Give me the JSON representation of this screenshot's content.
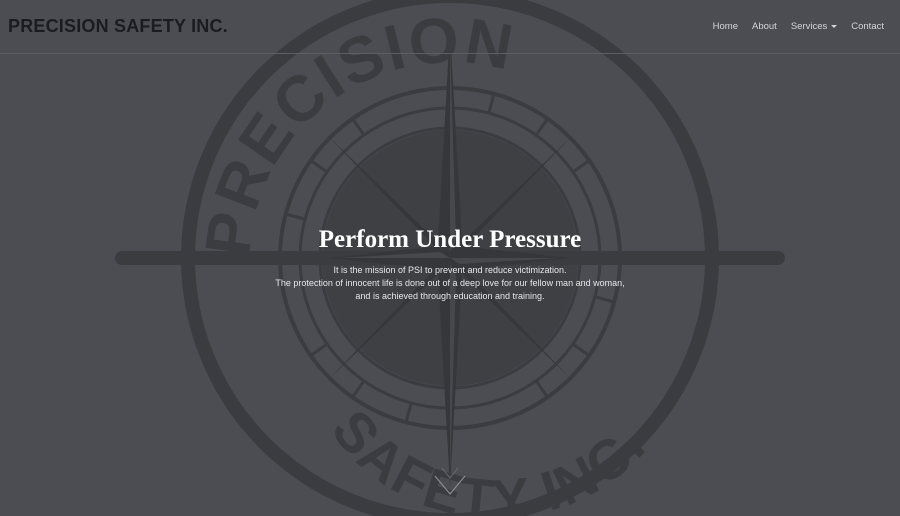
{
  "brand": {
    "name": "PRECISION SAFETY INC."
  },
  "nav": {
    "items": [
      {
        "label": "Home"
      },
      {
        "label": "About"
      },
      {
        "label": "Services",
        "dropdown": true
      },
      {
        "label": "Contact"
      }
    ]
  },
  "hero": {
    "title": "Perform Under Pressure",
    "lines": [
      "It is the mission of PSI to prevent and reduce victimization.",
      "The protection of innocent life is done out of a deep love for our fellow man and woman,",
      "and is achieved through education and training."
    ]
  },
  "background": {
    "emblem_top_text": "PRECISION",
    "emblem_bottom_text": "SAFETY INC.",
    "colors": {
      "page": "#4b4d52",
      "emblem": "#3a3c40"
    }
  },
  "icons": {
    "scroll": "chevron-down-icon",
    "dropdown": "caret-down-icon"
  }
}
